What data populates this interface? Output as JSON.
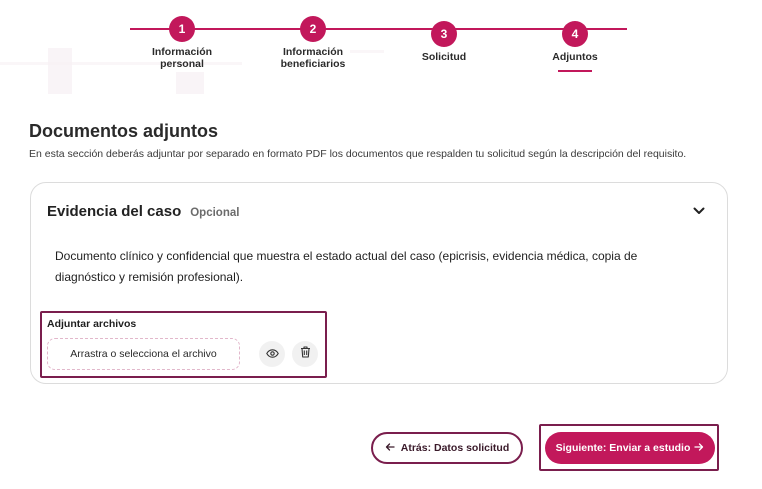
{
  "stepper": {
    "steps": [
      {
        "number": "1",
        "label_line1": "Información",
        "label_line2": "personal"
      },
      {
        "number": "2",
        "label_line1": "Información",
        "label_line2": "beneficiarios"
      },
      {
        "number": "3",
        "label_line1": "Solicitud",
        "label_line2": ""
      },
      {
        "number": "4",
        "label_line1": "Adjuntos",
        "label_line2": ""
      }
    ],
    "active_step": 4
  },
  "page": {
    "title": "Documentos adjuntos",
    "description": "En esta sección deberás adjuntar por separado en formato PDF los documentos que respalden tu solicitud según la descripción del requisito."
  },
  "card": {
    "title": "Evidencia del caso",
    "tag": "Opcional",
    "body": "Documento clínico y confidencial que muestra el estado actual del caso (epicrisis, evidencia médica, copia de diagnóstico y remisión profesional).",
    "expand_icon": "chevron-down-icon"
  },
  "upload": {
    "label": "Adjuntar archivos",
    "dropzone_text": "Arrastra o selecciona el archivo",
    "view_icon": "eye-icon",
    "delete_icon": "trash-icon"
  },
  "footer": {
    "back_label": "Atrás: Datos solicitud",
    "next_label": "Siguiente: Enviar a estudio"
  },
  "colors": {
    "accent": "#c2185b",
    "outline": "#7a1e4d"
  }
}
